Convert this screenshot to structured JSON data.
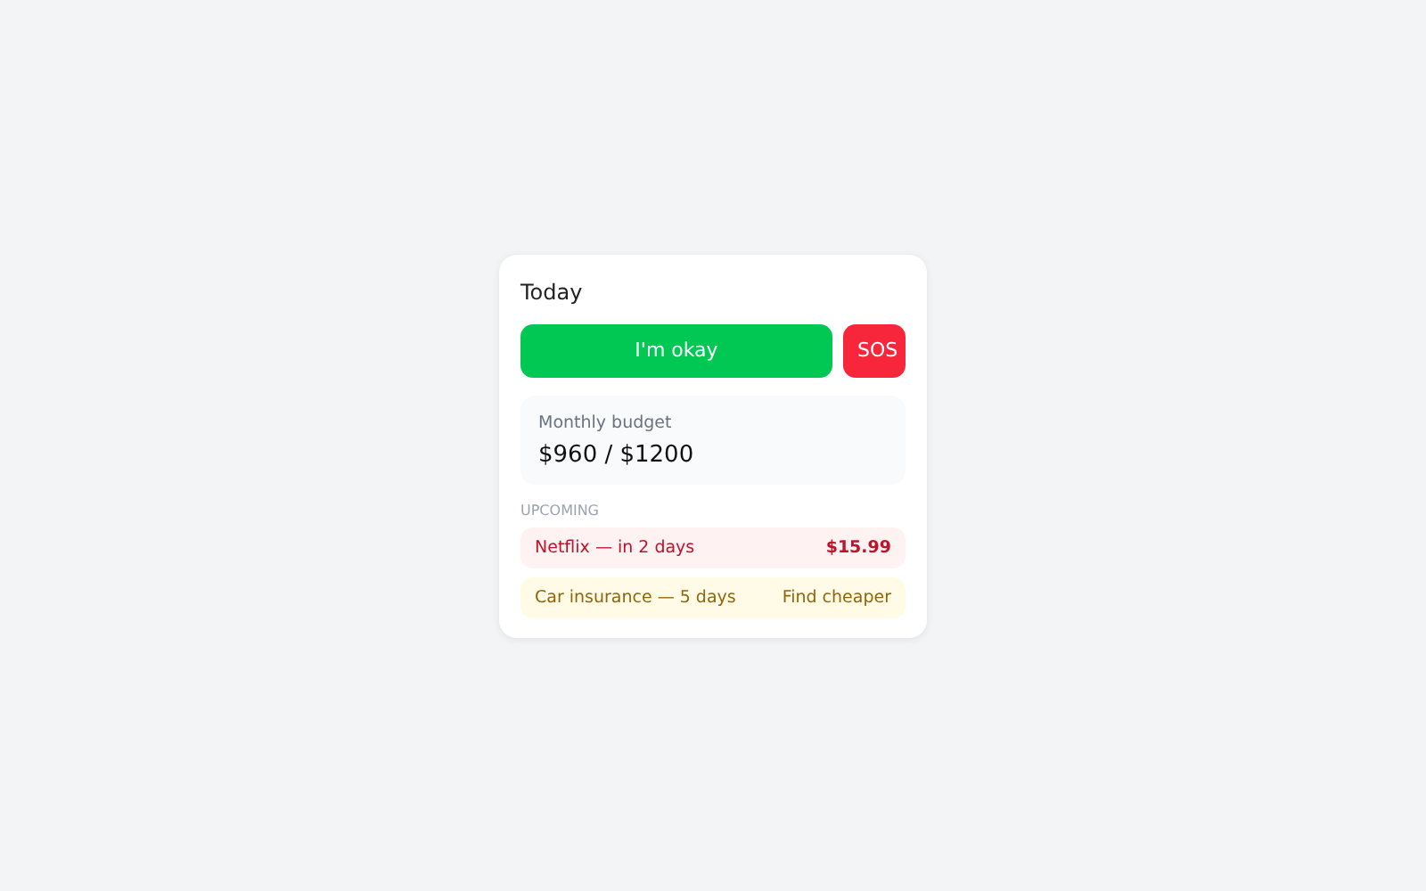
{
  "card": {
    "title": "Today",
    "buttons": [
      {
        "label": "I'm okay",
        "kind": "ok"
      },
      {
        "label": "SOS",
        "kind": "sos"
      }
    ],
    "budget": {
      "label": "Monthly budget",
      "value": "$960 / $1200"
    },
    "upcoming": {
      "heading": "UPCOMING",
      "items": [
        {
          "text": "Netflix — in 2 days",
          "detail": "$15.99",
          "kind": "alert"
        },
        {
          "text": "Car insurance — 5 days",
          "detail": "Find cheaper",
          "kind": "warning"
        }
      ]
    }
  }
}
